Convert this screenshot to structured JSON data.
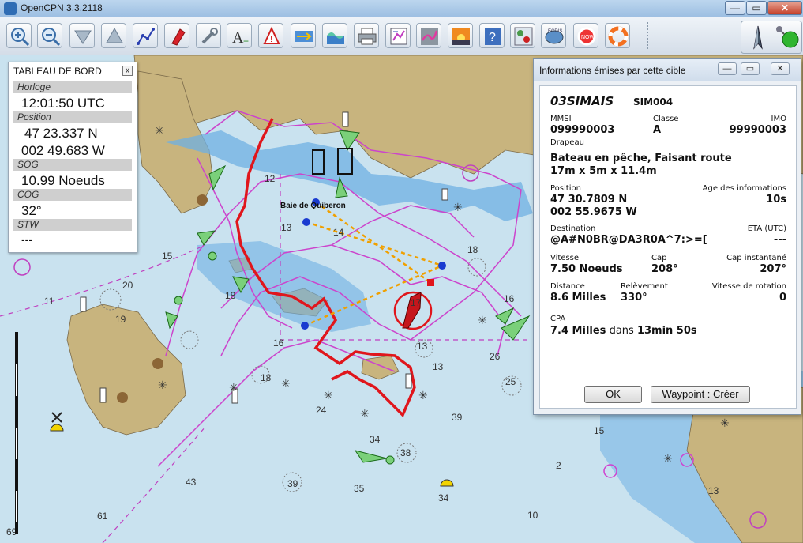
{
  "window": {
    "title": "OpenCPN 3.3.2118",
    "controls": {
      "minimize": "—",
      "maximize": "▭",
      "close": "✕"
    }
  },
  "toolbar": {
    "tools": [
      "zoom-in",
      "zoom-out",
      "chart-scale-down",
      "chart-scale-up",
      "route",
      "follow-ship",
      "settings",
      "text-annotation",
      "ais-alert",
      "current",
      "tide",
      "print",
      "route-manager",
      "track",
      "day-night",
      "help",
      "ais-targets",
      "ecdis",
      "man-overboard-nowo",
      "lifebuoy"
    ],
    "right": [
      "compass",
      "gps-status"
    ]
  },
  "dashboard": {
    "title": "TABLEAU DE BORD",
    "close": "x",
    "clock": {
      "caption": "Horloge",
      "value": "12:01:50 UTC"
    },
    "position": {
      "caption": "Position",
      "lat": "47 23.337 N",
      "lon": "002 49.683 W"
    },
    "sog": {
      "caption": "SOG",
      "value": "10.99 Noeuds"
    },
    "cog": {
      "caption": "COG",
      "value": "32°"
    },
    "stw": {
      "caption": "STW",
      "value": "---"
    }
  },
  "map": {
    "place_name": "Baie de Quiberon",
    "soundings": [
      "12",
      "14",
      "13",
      "15",
      "20",
      "11",
      "19",
      "16",
      "18",
      "24",
      "26",
      "34",
      "35",
      "38",
      "39",
      "43",
      "61",
      "69",
      "39",
      "2",
      "15",
      "10",
      "16",
      "13",
      "18",
      "25",
      "14",
      "17"
    ]
  },
  "ais_dialog": {
    "title": "Informations émises par cette cible",
    "name": "03SIMAIS",
    "callsign": "SIM004",
    "mmsi": {
      "label": "MMSI",
      "value": "099990003"
    },
    "class": {
      "label": "Classe",
      "value": "A"
    },
    "imo": {
      "label": "IMO",
      "value": "99990003"
    },
    "flag": {
      "label": "Drapeau",
      "value": ""
    },
    "status": "Bateau en pêche, Faisant route",
    "dimensions": "17m x 5m x 11.4m",
    "position": {
      "label": "Position",
      "lat": "47 30.7809 N",
      "lon": "002 55.9675 W"
    },
    "age": {
      "label": "Age des informations",
      "value": "10s"
    },
    "destination": {
      "label": "Destination",
      "value": "@A#N0BR@DA3R0A^7:>=["
    },
    "eta": {
      "label": "ETA (UTC)",
      "value": "---"
    },
    "speed": {
      "label": "Vitesse",
      "value": "7.50 Noeuds"
    },
    "course": {
      "label": "Cap",
      "value": "208°"
    },
    "heading": {
      "label": "Cap instantané",
      "value": "207°"
    },
    "distance": {
      "label": "Distance",
      "value": "8.6 Milles"
    },
    "bearing": {
      "label": "Relèvement",
      "value": "330°"
    },
    "rot": {
      "label": "Vitesse de rotation",
      "value": "0"
    },
    "cpa": {
      "label": "CPA",
      "value": "7.4 Milles",
      "connector": "dans",
      "time": "13min 50s"
    },
    "ok_button": "OK",
    "waypoint_button": "Waypoint : Créer"
  },
  "colors": {
    "sea": "#c9e2ef",
    "shallow": "#6fb0e3",
    "land": "#c8b47e",
    "track": "#cc44cc",
    "ais_track": "#e0161c",
    "cpa_line": "#f0a000"
  }
}
